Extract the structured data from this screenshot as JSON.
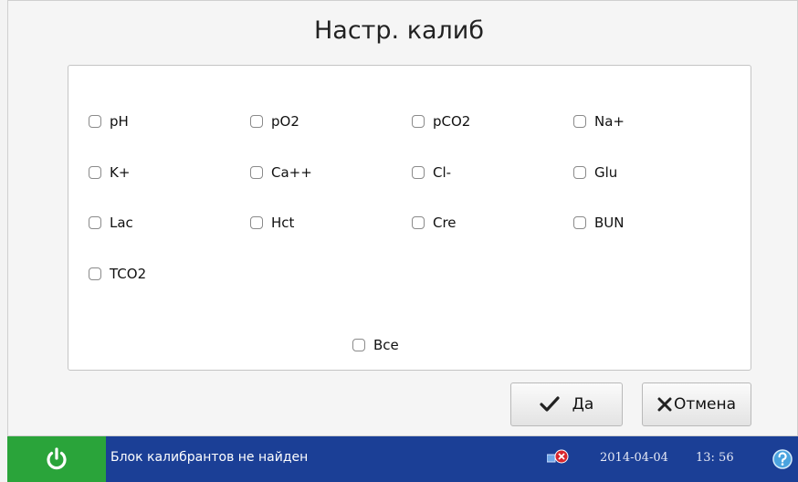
{
  "dialog": {
    "title": "Настр. калиб"
  },
  "checkboxes": {
    "ph": "pH",
    "po2": "pO2",
    "pco2": "pCO2",
    "na": "Na+",
    "k": "K+",
    "ca": "Ca++",
    "cl": "Cl-",
    "glu": "Glu",
    "lac": "Lac",
    "hct": "Hct",
    "cre": "Cre",
    "bun": "BUN",
    "tco2": "TCO2",
    "all": "Все"
  },
  "buttons": {
    "ok_label": "Да",
    "cancel_label": "Отмена"
  },
  "statusbar": {
    "message": "Блок калибрантов не найден",
    "date": "2014-04-04",
    "time": "13: 56",
    "power_icon": "power-icon",
    "network_error_icon": "network-error-icon",
    "help_icon": "help-icon"
  },
  "colors": {
    "status_bg": "#1b3f96",
    "power_bg": "#2aa43a",
    "help": "#4aa3df"
  }
}
